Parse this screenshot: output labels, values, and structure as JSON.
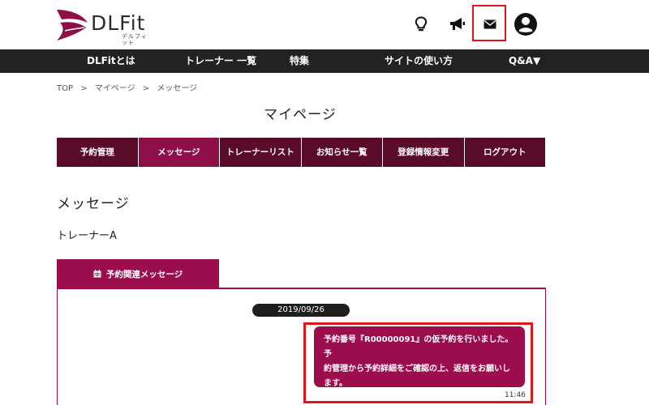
{
  "header": {
    "logo_text": "DLFit",
    "logo_sub": "デルフィット",
    "icons": [
      "lightbulb-icon",
      "megaphone-icon",
      "mail-icon",
      "user-icon"
    ],
    "brand_color": "#8e0e47",
    "highlight_color": "#e0141e"
  },
  "nav": {
    "items": [
      "DLFitとは",
      "トレーナー 一覧",
      "特集",
      "サイトの使い方",
      "Q&A▼"
    ]
  },
  "breadcrumb": {
    "items": [
      "TOP",
      ">",
      "マイページ",
      ">",
      "メッセージ"
    ]
  },
  "page": {
    "title": "マイページ"
  },
  "tabs": [
    {
      "label": "予約管理"
    },
    {
      "label": "メッセージ"
    },
    {
      "label": "トレーナーリスト"
    },
    {
      "label": "お知らせ一覧"
    },
    {
      "label": "登録情報変更"
    },
    {
      "label": "ログアウト"
    }
  ],
  "messages": {
    "section_title": "メッセージ",
    "trainer": "トレーナーA",
    "panel_tab": "予約関連メッセージ",
    "date": "2019/09/26",
    "bubble_line1": "予約番号『R00000091』の仮予約を行いました。予",
    "bubble_line2": "約管理から予約詳細をご確認の上、返信をお願いし",
    "bubble_line3": "ます。",
    "time": "11:46"
  }
}
